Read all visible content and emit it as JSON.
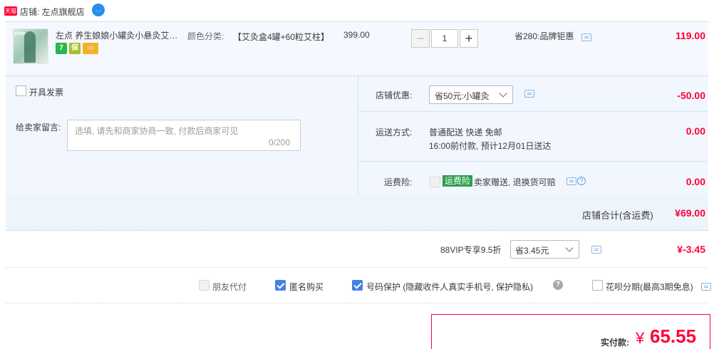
{
  "shop": {
    "badge": "天猫",
    "label": "店铺: 左点旗舰店",
    "chat_icon_text": "…"
  },
  "item": {
    "thumb_text": "zdee",
    "title": "左点 养生娘娘小罐灸小悬灸艾…",
    "service_icons": [
      "7",
      "保",
      "▭"
    ],
    "sku_label": "颜色分类:",
    "sku_value": "【艾灸盒4罐+60粒艾柱】",
    "unit_price": "399.00",
    "quantity": "1",
    "qty_minus": "−",
    "qty_plus": "+",
    "discount_note": "省280:品牌钜惠",
    "price": "119.00"
  },
  "invoice": {
    "label": "开具发票"
  },
  "message": {
    "label": "给卖家留言:",
    "placeholder": "选填, 请先和商家协商一致, 付款后商家可见",
    "count": "0/200"
  },
  "coupon": {
    "label": "店铺优惠:",
    "selected": "省50元:小罐灸",
    "amount": "-50.00"
  },
  "shipping": {
    "label": "运送方式:",
    "line1": "普通配送 快递 免邮",
    "line2": "16:00前付款, 预计12月01日送达",
    "amount": "0.00"
  },
  "insurance": {
    "label": "运费险:",
    "badge": "运费险",
    "desc": "卖家赠送, 退换货可赔",
    "amount": "0.00"
  },
  "subtotal": {
    "label": "店铺合计(含运费)",
    "amount": "¥69.00"
  },
  "vip": {
    "label": "88VIP专享9.5折",
    "selected": "省3.45元",
    "amount": "¥-3.45"
  },
  "options": {
    "friend_pay": "朋友代付",
    "anonymous": "匿名购买",
    "number_protect": "号码保护 (隐藏收件人真实手机号, 保护隐私)",
    "huabei": "花呗分期(最高3期免息)",
    "help_glyph": "?"
  },
  "total": {
    "label": "实付款:",
    "currency": "¥",
    "amount": "65.55"
  },
  "colors": {
    "accent_red": "#ff0036",
    "check_blue": "#4a7fe0",
    "insurance_green": "#2d9e4f"
  }
}
